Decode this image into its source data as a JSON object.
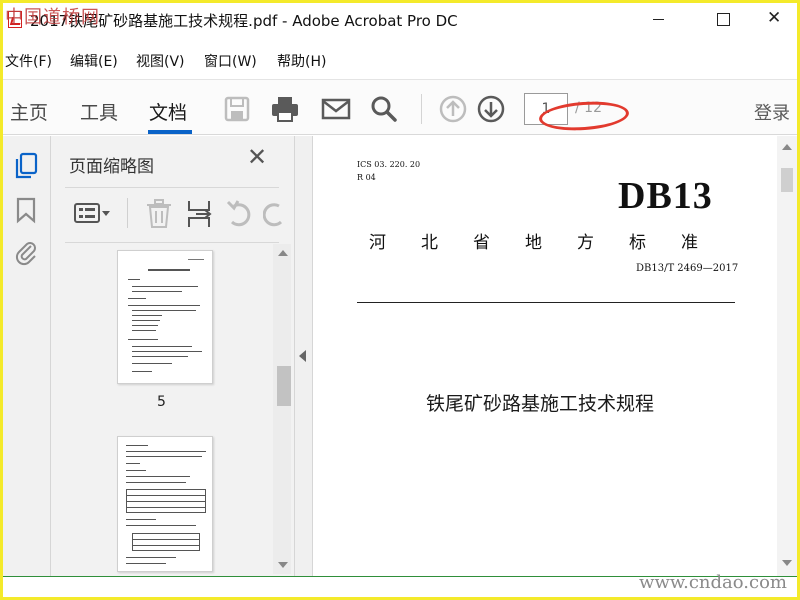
{
  "watermarks": {
    "top": "中国道桥网",
    "bottom": "www.cndao.com"
  },
  "window": {
    "title": "2017铁尾矿砂路基施工技术规程.pdf - Adobe Acrobat Pro DC",
    "close_glyph": "✕"
  },
  "menu": {
    "file": "文件(F)",
    "edit": "编辑(E)",
    "view": "视图(V)",
    "window": "窗口(W)",
    "help": "帮助(H)"
  },
  "toolbar": {
    "tabs": [
      "主页",
      "工具",
      "文档"
    ],
    "active_tab": "文档",
    "page_current": "1",
    "page_total": "/ 12",
    "sign_in": "登录",
    "icons": [
      "save-icon",
      "print-icon",
      "mail-icon",
      "search-icon",
      "prev-page-icon",
      "next-page-icon"
    ]
  },
  "rail": {
    "icons": [
      "page-thumbnails-icon",
      "bookmark-icon",
      "attachment-icon"
    ]
  },
  "thumbnails": {
    "title": "页面缩略图",
    "close_glyph": "✕",
    "tools": [
      "options-icon",
      "delete-icon",
      "insert-icon",
      "undo-icon",
      "redo-icon"
    ],
    "pages": [
      {
        "number": "5"
      },
      {
        "number": ""
      }
    ]
  },
  "document": {
    "ics": "ICS 03. 220. 20",
    "r_code": "R 04",
    "prefix": "DB13",
    "province": "河北省地方标准",
    "standard_no": "DB13/T 2469—2017",
    "title": "铁尾矿砂路基施工技术规程"
  },
  "colors": {
    "accent": "#0a63c8",
    "annotation_red": "#e23a2e",
    "frame_yellow": "#f4ea2a"
  }
}
